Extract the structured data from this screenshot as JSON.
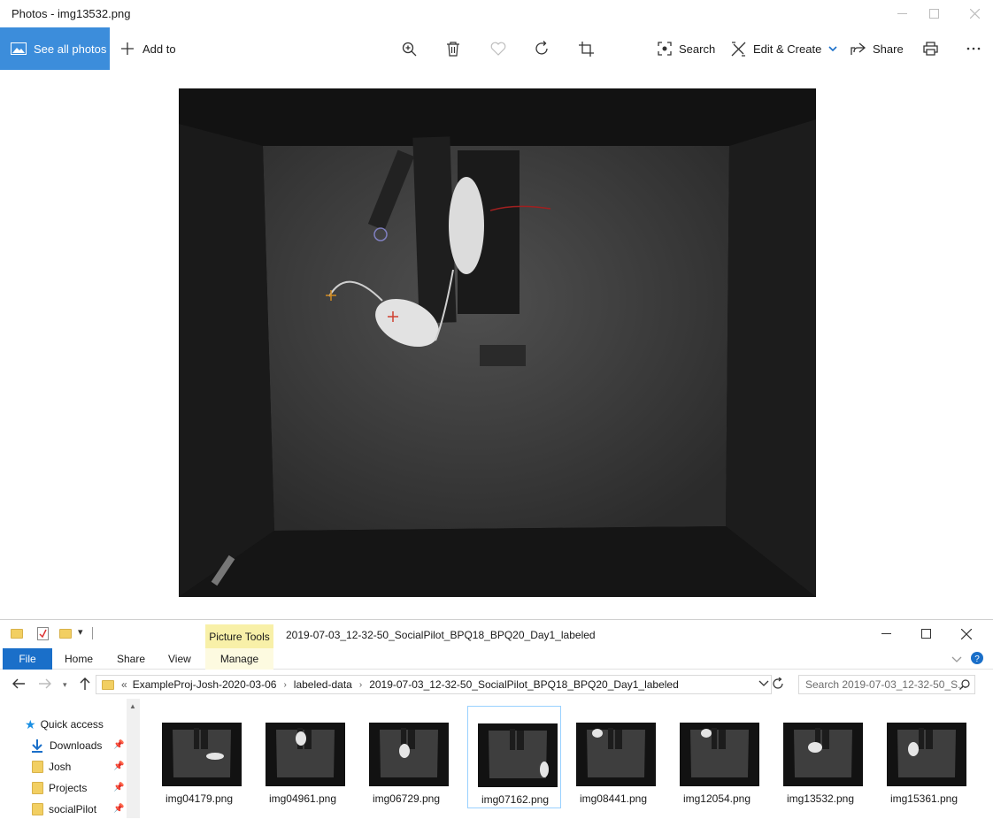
{
  "photos": {
    "window_title": "Photos - img13532.png",
    "toolbar": {
      "see_all_label": "See all photos",
      "add_to_label": "Add to",
      "search_label": "Search",
      "edit_create_label": "Edit & Create",
      "share_label": "Share"
    }
  },
  "explorer": {
    "title": "2019-07-03_12-32-50_SocialPilot_BPQ18_BPQ20_Day1_labeled",
    "picture_tools_label": "Picture Tools",
    "ribbon_tabs": {
      "file": "File",
      "home": "Home",
      "share": "Share",
      "view": "View",
      "manage": "Manage"
    },
    "address": {
      "prefix": "«",
      "segments": [
        "ExampleProj-Josh-2020-03-06",
        "labeled-data",
        "2019-07-03_12-32-50_SocialPilot_BPQ18_BPQ20_Day1_labeled"
      ]
    },
    "search_placeholder": "Search 2019-07-03_12-32-50_S...",
    "nav": {
      "quick_access": "Quick access",
      "items": [
        "Downloads",
        "Josh",
        "Projects",
        "socialPilot"
      ]
    },
    "files": [
      "img04179.png",
      "img04961.png",
      "img06729.png",
      "img07162.png",
      "img08441.png",
      "img12054.png",
      "img13532.png",
      "img15361.png"
    ]
  }
}
